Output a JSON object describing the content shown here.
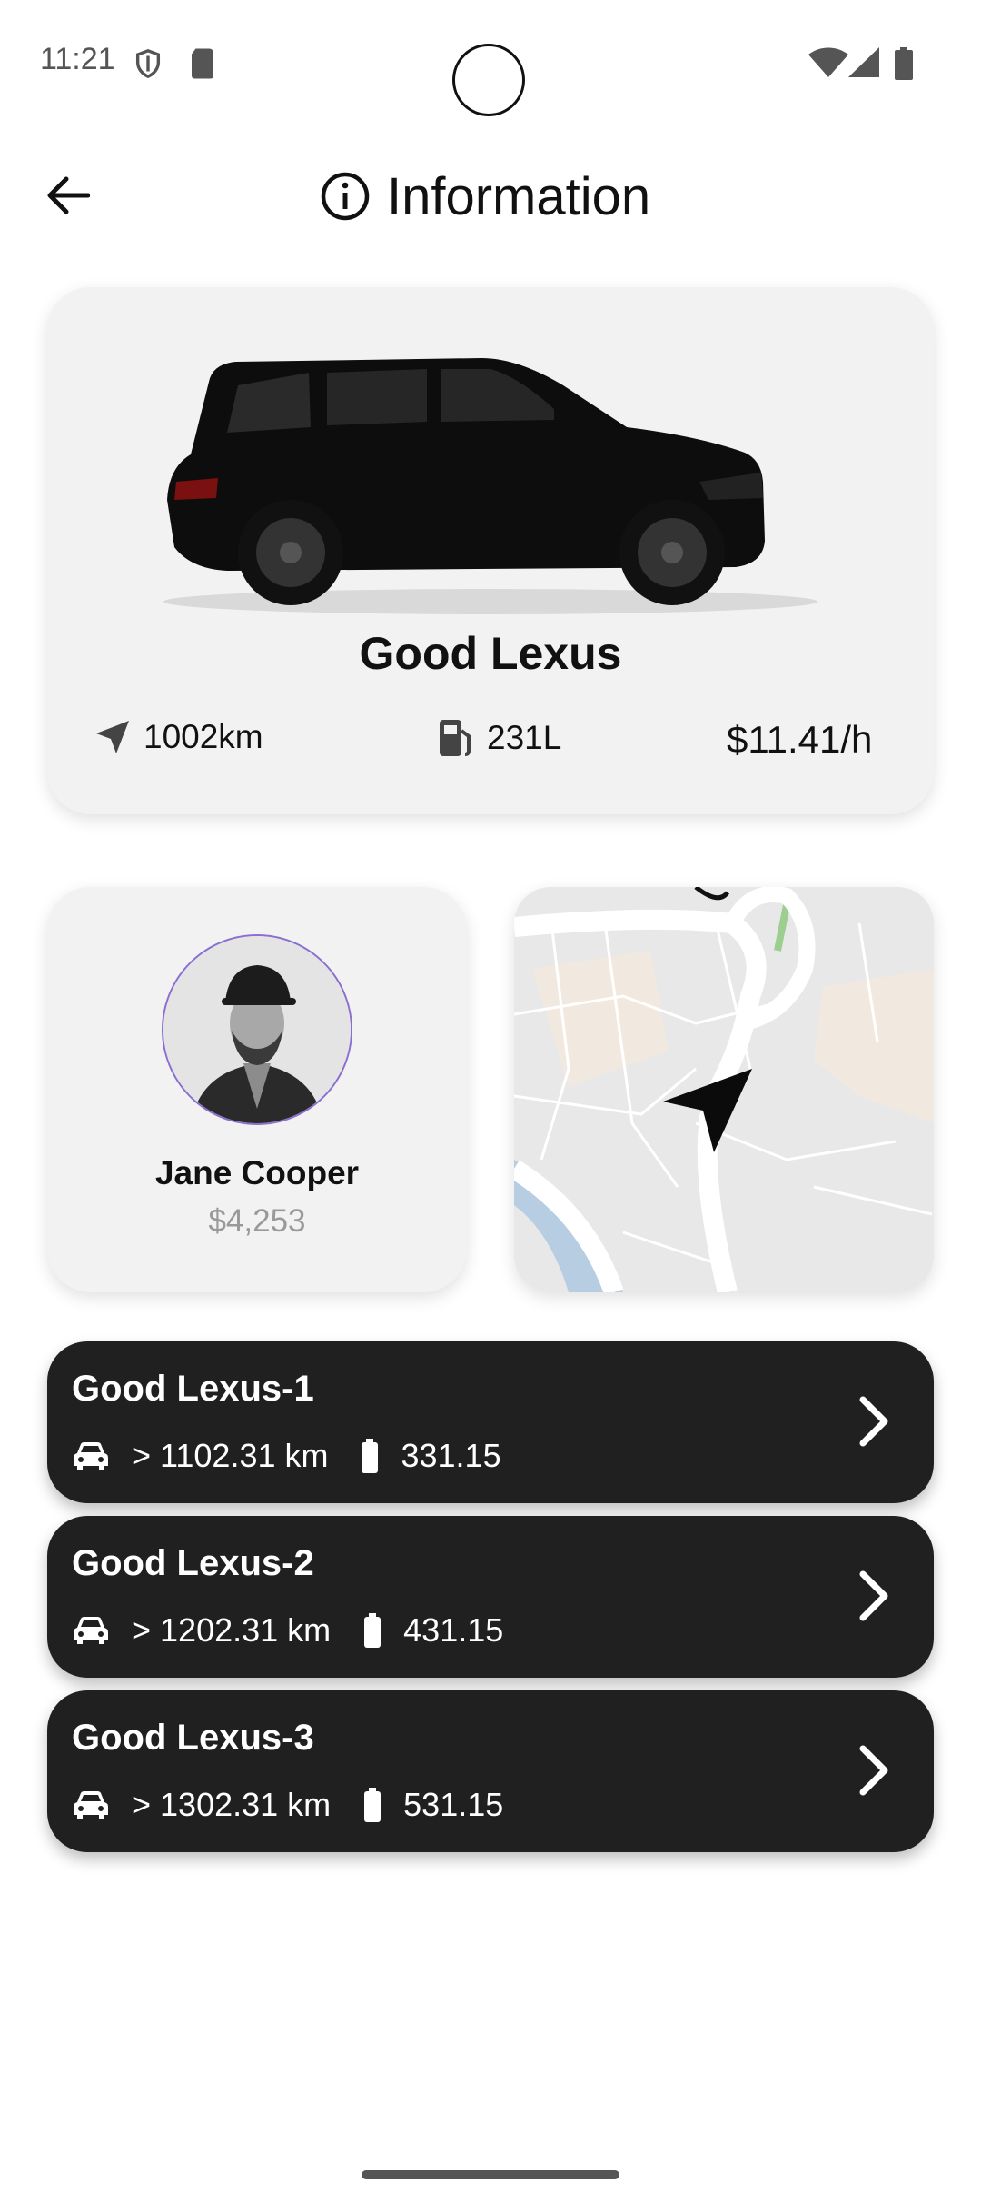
{
  "status_bar": {
    "time": "11:21"
  },
  "header": {
    "title": "Information"
  },
  "vehicle": {
    "name": "Good Lexus",
    "distance": "1002km",
    "fuel": "231L",
    "price": "$11.41/h"
  },
  "driver": {
    "name": "Jane Cooper",
    "balance": "$4,253"
  },
  "trips": [
    {
      "title": "Good Lexus-1",
      "distance": "> 1102.31 km",
      "battery": "331.15"
    },
    {
      "title": "Good Lexus-2",
      "distance": "> 1202.31 km",
      "battery": "431.15"
    },
    {
      "title": "Good Lexus-3",
      "distance": "> 1302.31 km",
      "battery": "531.15"
    }
  ],
  "colors": {
    "card_bg": "#f2f2f2",
    "trip_bg": "#202020",
    "avatar_ring": "#8a6fd1"
  }
}
